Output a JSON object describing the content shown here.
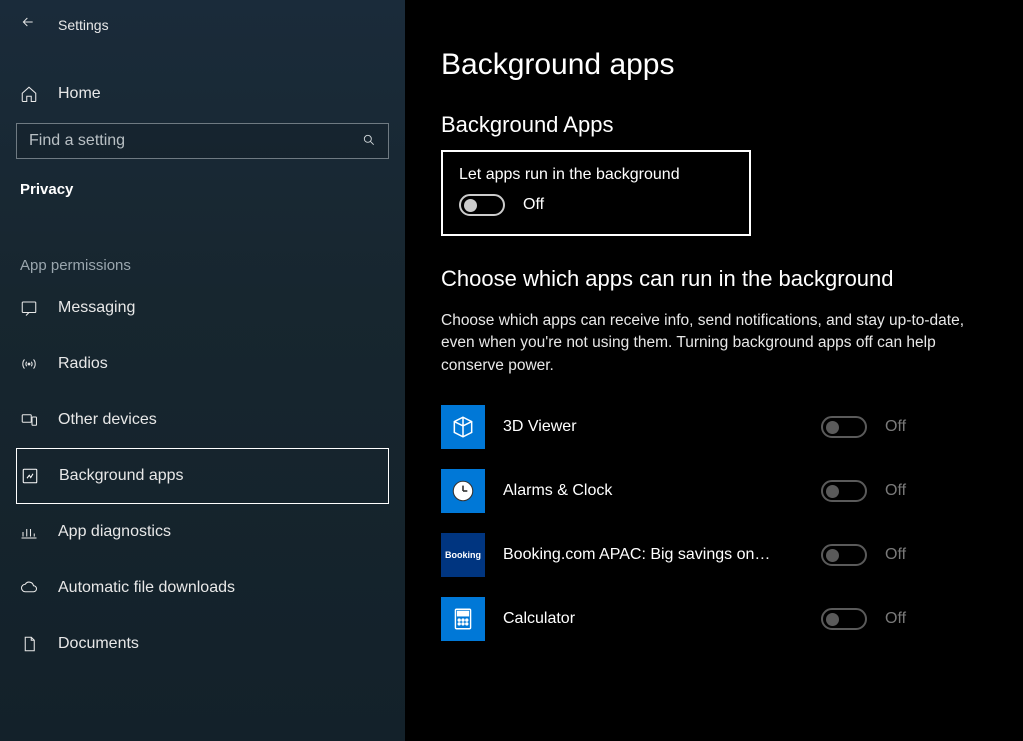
{
  "header": {
    "settings_label": "Settings",
    "home_label": "Home",
    "search_placeholder": "Find a setting",
    "section_label": "Privacy",
    "subsection_label": "App permissions"
  },
  "sidebar": {
    "items": [
      {
        "label": "Messaging"
      },
      {
        "label": "Radios"
      },
      {
        "label": "Other devices"
      },
      {
        "label": "Background apps"
      },
      {
        "label": "App diagnostics"
      },
      {
        "label": "Automatic file downloads"
      },
      {
        "label": "Documents"
      }
    ]
  },
  "main": {
    "page_title": "Background apps",
    "group_title": "Background Apps",
    "master_toggle_label": "Let apps run in the background",
    "master_toggle_state": "Off",
    "choose_title": "Choose which apps can run in the background",
    "choose_desc": "Choose which apps can receive info, send notifications, and stay up-to-date, even when you're not using them. Turning background apps off can help conserve power.",
    "apps": [
      {
        "name": "3D Viewer",
        "state": "Off"
      },
      {
        "name": "Alarms & Clock",
        "state": "Off"
      },
      {
        "name": "Booking.com APAC: Big savings on…",
        "state": "Off"
      },
      {
        "name": "Calculator",
        "state": "Off"
      }
    ]
  }
}
